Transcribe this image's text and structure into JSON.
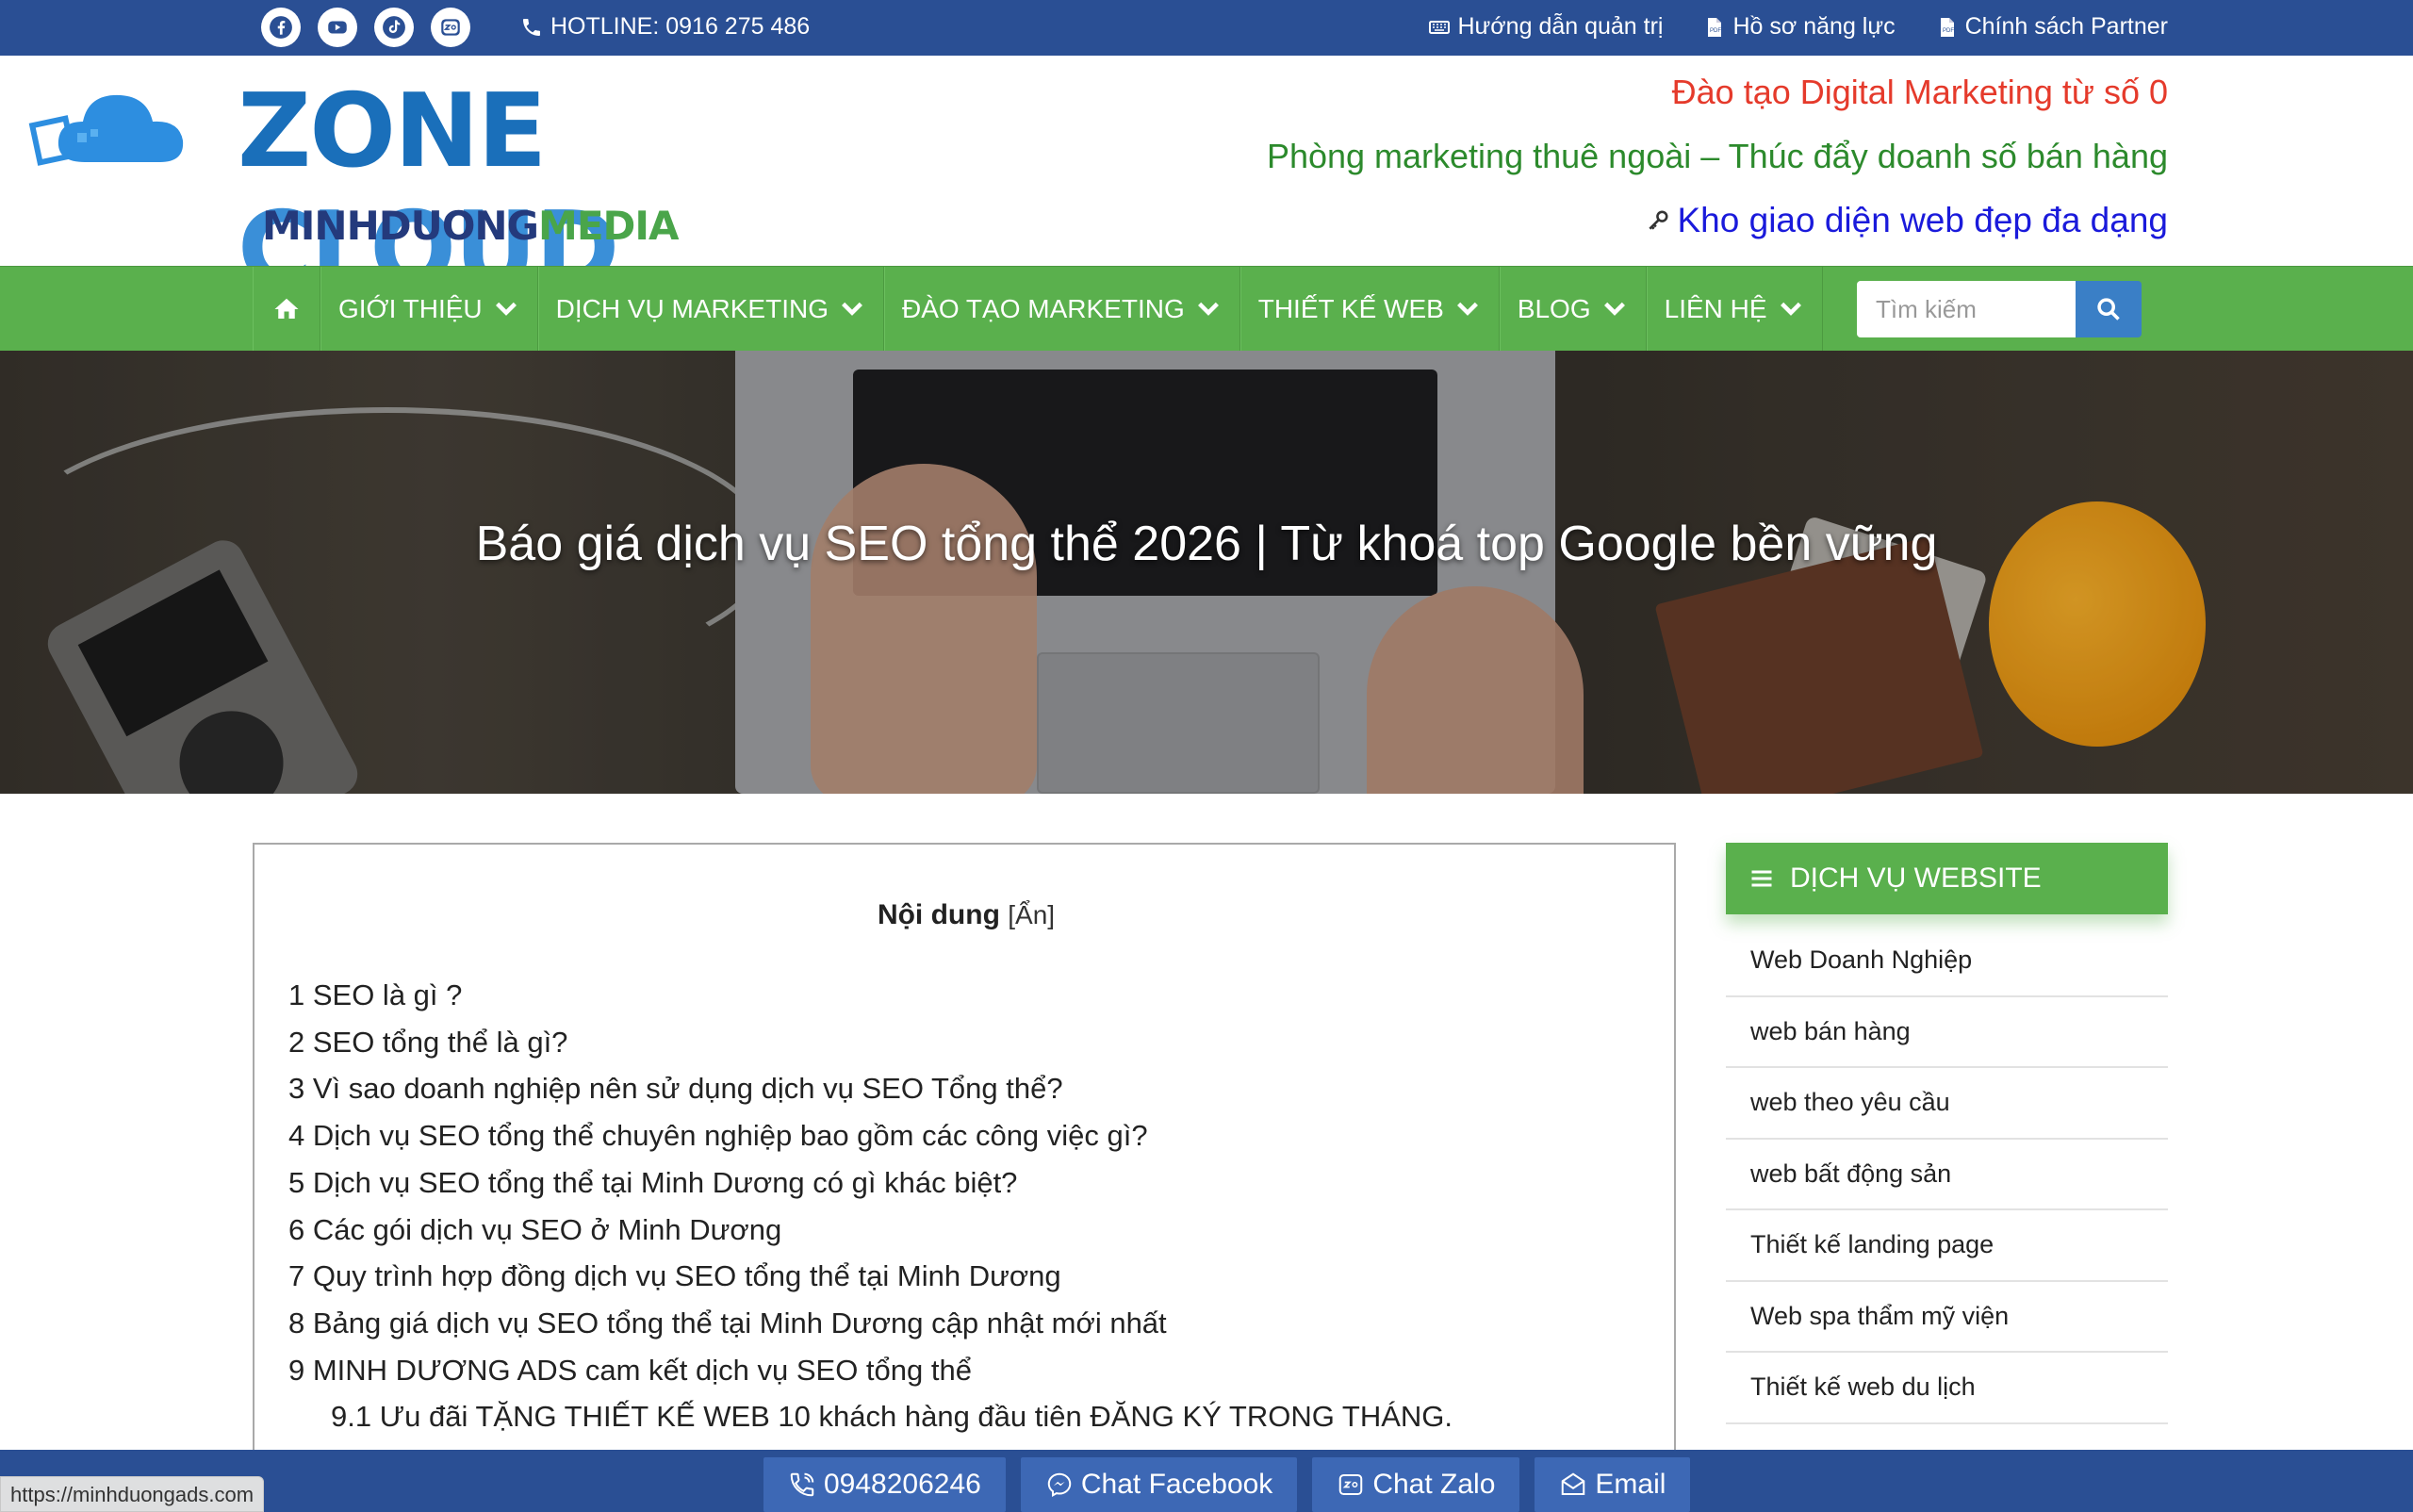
{
  "topbar": {
    "hotline": "HOTLINE: 0916 275 486",
    "links": [
      "Hướng dẫn quản trị",
      "Hồ sơ năng lực",
      "Chính sách Partner"
    ]
  },
  "header": {
    "logo_main_1": "ZONE",
    "logo_main_2": "CLOUD",
    "logo_sub_1": "MINHDUONG",
    "logo_sub_2": "MEDIA",
    "tagline1": "Đào tạo Digital Marketing từ số 0",
    "tagline2": "Phòng marketing thuê ngoài – Thúc đẩy doanh số bán hàng",
    "tagline3": "Kho giao diện web đẹp đa dạng"
  },
  "nav": {
    "items": [
      "GIỚI THIỆU",
      "DỊCH VỤ MARKETING",
      "ĐÀO TẠO MARKETING",
      "THIẾT KẾ WEB",
      "BLOG",
      "LIÊN HỆ"
    ],
    "search_placeholder": "Tìm kiếm"
  },
  "hero": {
    "title": "Báo giá dịch vụ SEO tổng thể 2026 | Từ khoá top Google bền vững"
  },
  "toc": {
    "heading": "Nội dung",
    "toggle": "[Ẩn]",
    "items": [
      "1 SEO là gì ?",
      "2 SEO tổng thể là gì?",
      "3 Vì sao doanh nghiệp nên sử dụng dịch vụ SEO Tổng thể?",
      "4 Dịch vụ SEO tổng thể chuyên nghiệp bao gồm các công việc gì?",
      "5 Dịch vụ SEO tổng thể tại Minh Dương có gì khác biệt?",
      "6 Các gói dịch vụ SEO ở Minh Dương",
      "7 Quy trình hợp đồng dịch vụ SEO tổng thể tại Minh Dương",
      "8 Bảng giá dịch vụ SEO tổng thể tại Minh Dương cập nhật mới nhất",
      "9 MINH DƯƠNG ADS cam kết dịch vụ SEO tổng thể"
    ],
    "subitem": "9.1 Ưu đãi TẶNG THIẾT KẾ WEB 10 khách hàng đầu tiên ĐĂNG KÝ TRONG THÁNG."
  },
  "sidebar": {
    "heading": "DỊCH VỤ WEBSITE",
    "items": [
      "Web Doanh Nghiệp",
      "web bán hàng",
      "web theo yêu cầu",
      "web bất động sản",
      "Thiết kế landing page",
      "Web spa thẩm mỹ viện",
      "Thiết kế web du lịch"
    ]
  },
  "bottombar": {
    "phone": "0948206246",
    "facebook": "Chat Facebook",
    "zalo": "Chat Zalo",
    "email": "Email"
  },
  "status_url": "https://minhduongads.com"
}
